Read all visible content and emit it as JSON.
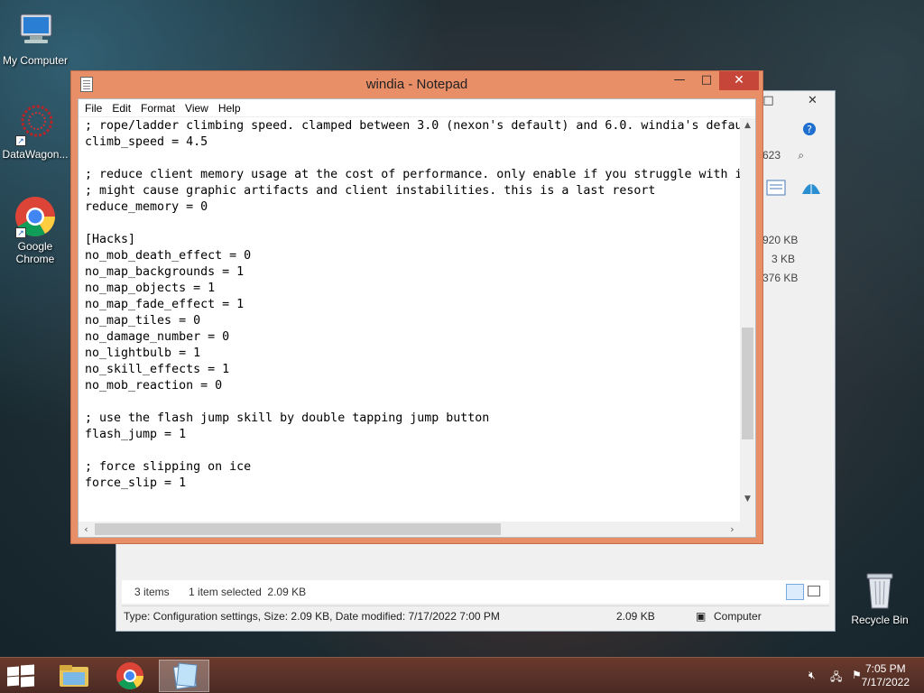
{
  "desktop": {
    "icons": [
      {
        "label": "My Computer"
      },
      {
        "label": "DataWagon..."
      },
      {
        "label": "Google Chrome"
      },
      {
        "label": "Recycle Bin"
      }
    ]
  },
  "explorer": {
    "sizes": [
      "920 KB",
      "3 KB",
      "376 KB"
    ],
    "search_partial": "623",
    "items_count": "3 items",
    "selection": "1 item selected  2.09 KB",
    "details": "Type: Configuration settings, Size: 2.09 KB, Date modified: 7/17/2022 7:00 PM",
    "size_cell": "2.09 KB",
    "location": "Computer"
  },
  "notepad": {
    "title": "windia - Notepad",
    "menu": [
      "File",
      "Edit",
      "Format",
      "View",
      "Help"
    ],
    "lines": [
      "; rope/ladder climbing speed. clamped between 3.0 (nexon's default) and 6.0. windia's defau",
      "climb_speed = 4.5",
      "",
      "; reduce client memory usage at the cost of performance. only enable if you struggle with i",
      "; might cause graphic artifacts and client instabilities. this is a last resort",
      "reduce_memory = 0",
      "",
      "[Hacks]",
      "no_mob_death_effect = 0",
      "no_map_backgrounds = 1",
      "no_map_objects = 1",
      "no_map_fade_effect = 1",
      "no_map_tiles = 0",
      "no_damage_number = 0",
      "no_lightbulb = 1",
      "no_skill_effects = 1",
      "no_mob_reaction = 0",
      "",
      "; use the flash jump skill by double tapping jump button",
      "flash_jump = 1",
      "",
      "; force slipping on ice",
      "force_slip = 1"
    ],
    "minimize": "—",
    "maximize": "□",
    "close": "✕"
  },
  "taskbar": {
    "time": "7:05 PM",
    "date": "7/17/2022"
  },
  "colors": {
    "notepad_frame": "#e98f68",
    "close_button": "#c7463a",
    "taskbar": "#5a3228"
  }
}
